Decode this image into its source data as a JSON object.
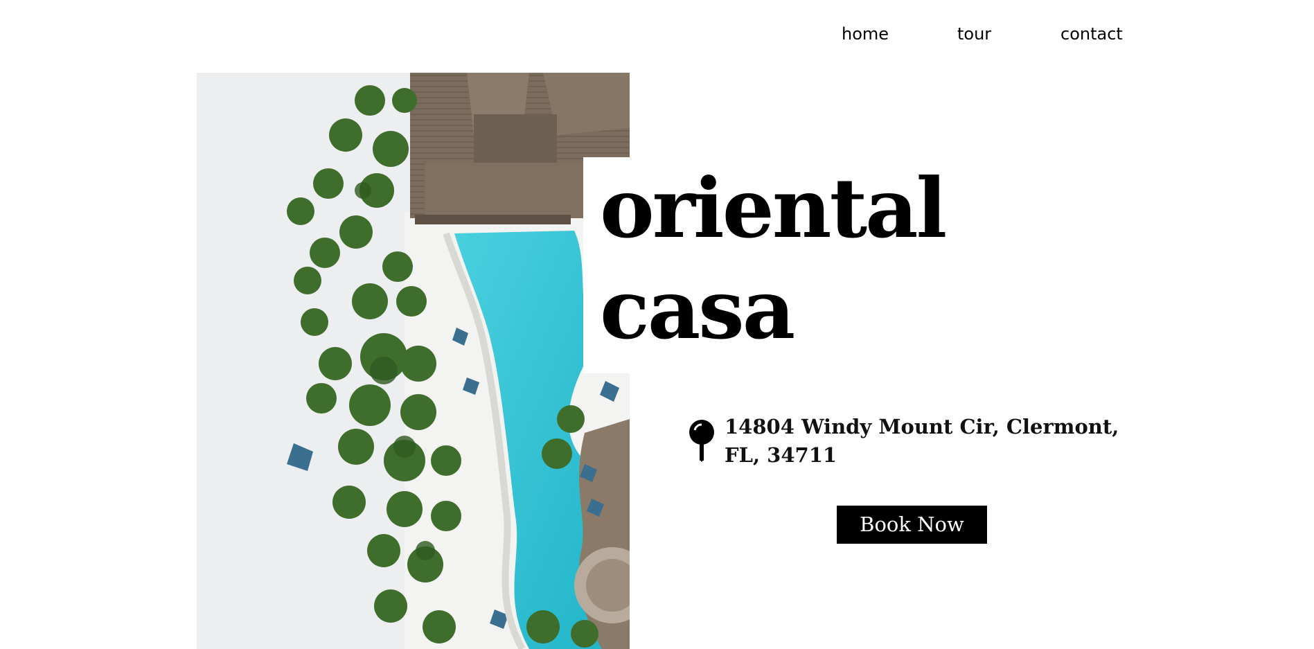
{
  "nav": {
    "items": [
      {
        "label": "home"
      },
      {
        "label": "tour"
      },
      {
        "label": "contact"
      }
    ]
  },
  "hero": {
    "image_description": "aerial-view-resort-pool-palm-trees-beach",
    "title_line1": "oriental",
    "title_line2": "casa"
  },
  "address": {
    "icon": "map-pin-icon",
    "text": "14804 Windy Mount Cir, Clermont, FL, 34711"
  },
  "cta": {
    "label": "Book Now"
  },
  "colors": {
    "background": "#ffffff",
    "text": "#000000",
    "button_bg": "#000000",
    "button_text": "#ffffff",
    "pool": "#2fc4d4",
    "sand": "#eceeef",
    "roof": "#7a6b5c",
    "palm": "#3d6b2a"
  }
}
